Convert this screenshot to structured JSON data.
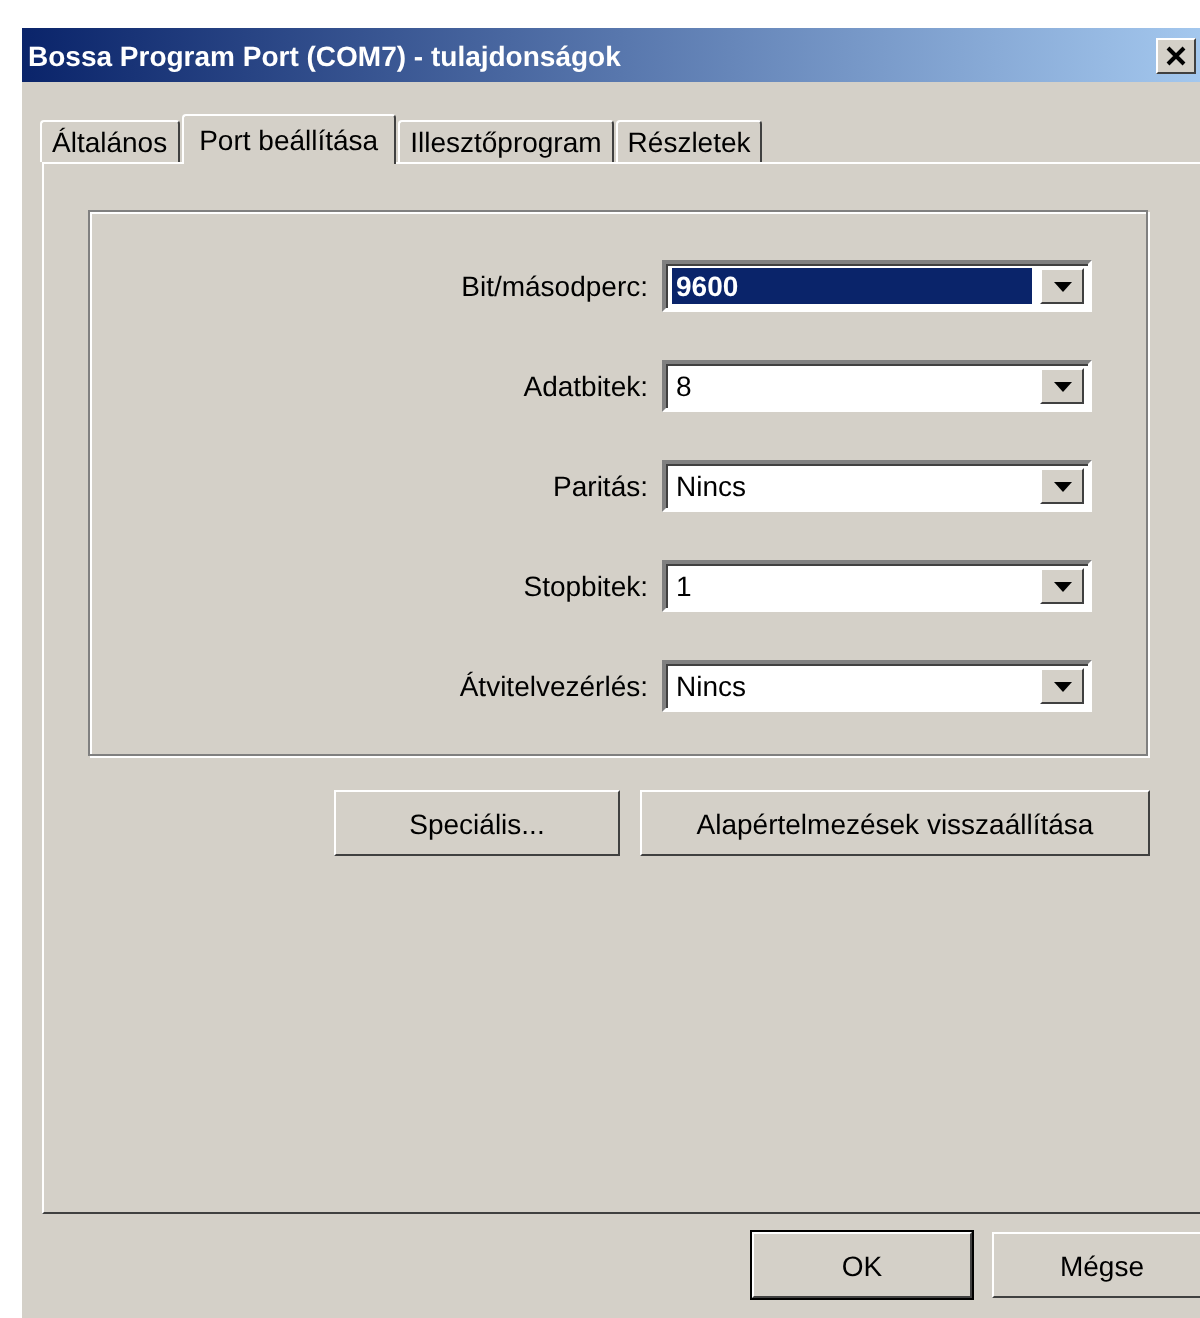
{
  "window": {
    "title": "Bossa Program Port (COM7) - tulajdonságok"
  },
  "tabs": [
    {
      "label": "Általános",
      "selected": false
    },
    {
      "label": "Port beállítása",
      "selected": true
    },
    {
      "label": "Illesztőprogram",
      "selected": false
    },
    {
      "label": "Részletek",
      "selected": false
    }
  ],
  "settings": [
    {
      "label": "Bit/másodperc:",
      "value": "9600",
      "focused": true
    },
    {
      "label": "Adatbitek:",
      "value": "8",
      "focused": false
    },
    {
      "label": "Paritás:",
      "value": "Nincs",
      "focused": false
    },
    {
      "label": "Stopbitek:",
      "value": "1",
      "focused": false
    },
    {
      "label": "Átvitelvezérlés:",
      "value": "Nincs",
      "focused": false
    }
  ],
  "panel_buttons": [
    "Speciális...",
    "Alapértelmezések visszaállítása"
  ],
  "dialog_buttons": [
    {
      "label": "OK",
      "default": true
    },
    {
      "label": "Mégse",
      "default": false
    }
  ]
}
